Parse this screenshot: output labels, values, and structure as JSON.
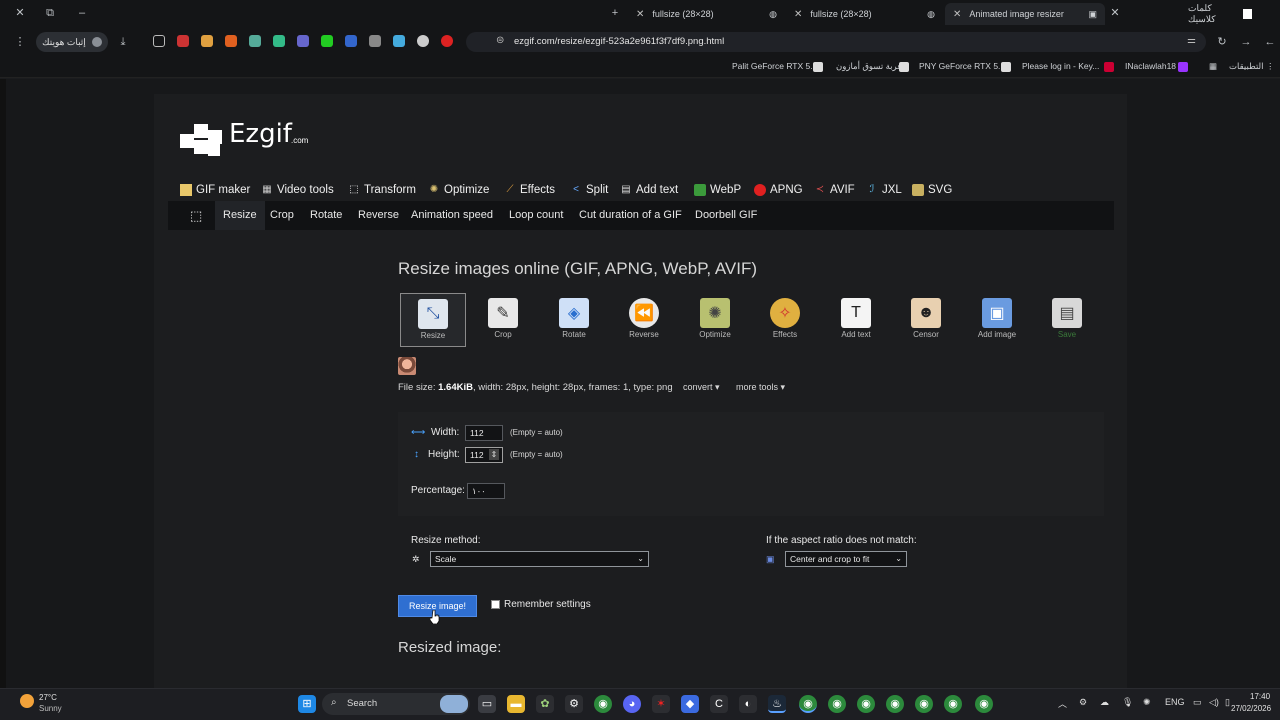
{
  "browser": {
    "tabs": [
      {
        "title": "fullsize (28×28)"
      },
      {
        "title": "fullsize (28×28)"
      },
      {
        "title": "Animated image resizer"
      },
      {
        "title": "كلمات كلاسيك"
      }
    ],
    "profile_label": "إثبات هويتك",
    "url": "ezgif.com/resize/ezgif-523a2e961f3f7df9.png.html",
    "bookmarks": [
      "Palit GeForce RTX 5...",
      "عربة تسوق أمازون",
      "PNY GeForce RTX 5...",
      "Please log in - Key...",
      "INaclawlah18",
      "التطبيقات"
    ]
  },
  "site": {
    "logo": "Ezgif",
    "logo_suffix": ".com",
    "main_nav": [
      "GIF maker",
      "Video tools",
      "Transform",
      "Optimize",
      "Effects",
      "Split",
      "Add text",
      "WebP",
      "APNG",
      "AVIF",
      "JXL",
      "SVG"
    ],
    "sub_nav": [
      "Resize",
      "Crop",
      "Rotate",
      "Reverse",
      "Animation speed",
      "Loop count",
      "Cut duration of a GIF",
      "Doorbell GIF"
    ],
    "page_title": "Resize images online (GIF, APNG, WebP, AVIF)",
    "tools": [
      "Resize",
      "Crop",
      "Rotate",
      "Reverse",
      "Optimize",
      "Effects",
      "Add text",
      "Censor",
      "Add image",
      "Save"
    ],
    "file_info": {
      "prefix": "File size: ",
      "size": "1.64KiB",
      "rest": ", width: 28px, height: 28px, frames: 1, type: png",
      "convert": "convert",
      "more_tools": "more tools"
    },
    "form": {
      "width_label": "Width:",
      "width_value": "112",
      "height_label": "Height:",
      "height_value": "112",
      "auto_note": "(Empty = auto)",
      "percentage_label": "Percentage:",
      "percentage_value": "١٠٠",
      "method_label": "Resize method:",
      "method_value": "Scale",
      "aspect_label": "If the aspect ratio does not match:",
      "aspect_value": "Center and crop to fit",
      "submit": "Resize image!",
      "remember": "Remember settings"
    },
    "resized_title": "Resized image:"
  },
  "taskbar": {
    "weather_temp": "27°C",
    "weather_desc": "Sunny",
    "search": "Search",
    "lang": "ENG",
    "time": "17:40",
    "date": "27/02/2026"
  },
  "colors": {
    "accent_button": "#2f6fd1",
    "page_bg": "#17181a",
    "container_bg": "#1c1d1f"
  }
}
